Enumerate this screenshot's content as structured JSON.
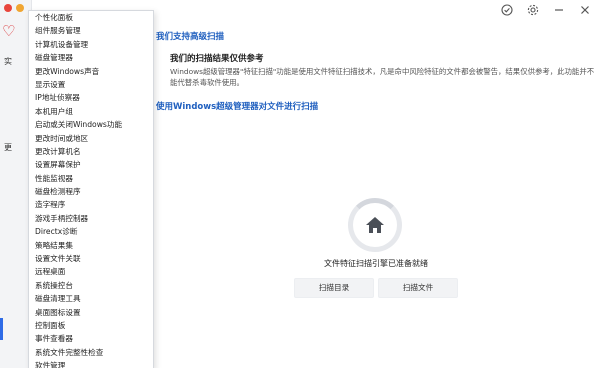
{
  "strip": {
    "label1": "实",
    "label2": "更"
  },
  "menu": {
    "items": [
      "个性化面板",
      "组件服务管理",
      "计算机设备管理",
      "磁盘管理器",
      "更改Windows声音",
      "显示设置",
      "IP地址侦察器",
      "本机用户组",
      "启动或关闭Windows功能",
      "更改时间或地区",
      "更改计算机名",
      "设置屏幕保护",
      "性能监视器",
      "磁盘检测程序",
      "造字程序",
      "游戏手柄控制器",
      "Directx诊断",
      "策略结果集",
      "设置文件关联",
      "远程桌面",
      "系统操控台",
      "磁盘清理工具",
      "桌面图标设置",
      "控制面板",
      "事件查看器",
      "系统文件完整性检查",
      "软件管理"
    ]
  },
  "main": {
    "support_link": "我们支持高级扫描",
    "ref_title": "我们的扫描结果仅供参考",
    "description": "Windows超级管理器\"特征扫描\"功能是使用文件特征扫描技术，凡是命中风险特征的文件都会被警告，结果仅供参考，此功能并不能代替杀毒软件使用。",
    "manage_link": "使用Windows超级管理器对文件进行扫描",
    "status": "文件特征扫描引擎已准备就绪",
    "scan_dir_button": "扫描目录",
    "scan_file_button": "扫描文件"
  },
  "colors": {
    "link": "#1f5fbf",
    "accent": "#2e6be6",
    "close_dot": "#e8453c",
    "min_dot": "#f0a531"
  },
  "icons": [
    "check-circle-icon",
    "gear-icon",
    "minimize-icon",
    "close-icon",
    "house-icon",
    "heart-icon"
  ]
}
